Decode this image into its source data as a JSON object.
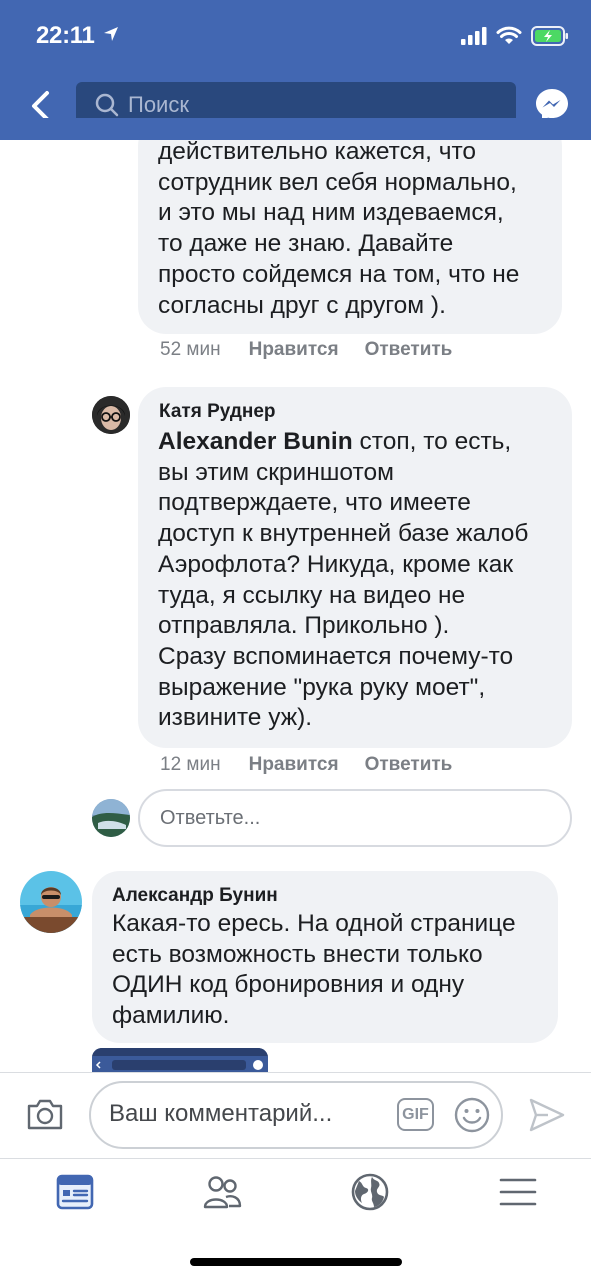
{
  "status_bar": {
    "time": "22:11"
  },
  "header": {
    "search_placeholder": "Поиск"
  },
  "comments": [
    {
      "author": "",
      "text": "действительно кажется, что\nсотрудник вел себя нормально,\nи это мы над ним издеваемся,\nто даже не знаю. Давайте\nпросто сойдемся на том, что не\nсогласны друг с другом ).",
      "time": "52 мин",
      "like_label": "Нравится",
      "reply_label": "Ответить"
    },
    {
      "author": "Катя Руднер",
      "mention": "Alexander  Bunin",
      "text_first": " стоп, то есть,",
      "text": "вы этим скриншотом\nподтверждаете, что имеете\nдоступ к внутренней базе жалоб\nАэрофлота? Никуда, кроме как\nтуда, я ссылку на видео не\nотправляла. Прикольно ).\nСразу вспоминается почему-то\nвыражение \"рука руку моет\",\nизвините уж).",
      "time": "12 мин",
      "like_label": "Нравится",
      "reply_label": "Ответить"
    },
    {
      "author": "Александр Бунин",
      "text": "Какая-то ересь. На одной странице\nесть возможность внести только\nОДИН код бронировния и одну\nфамилию."
    }
  ],
  "reply_placeholder": "Ответьте...",
  "compose": {
    "placeholder": "Ваш комментарий...",
    "gif_label": "GIF"
  },
  "tabs": [
    "news-feed",
    "friends",
    "notifications-globe",
    "menu"
  ],
  "colors": {
    "brand": "#4267b2",
    "search_bg": "#29487d",
    "bubble": "#f0f2f5",
    "active_tab": "#4267b2"
  }
}
